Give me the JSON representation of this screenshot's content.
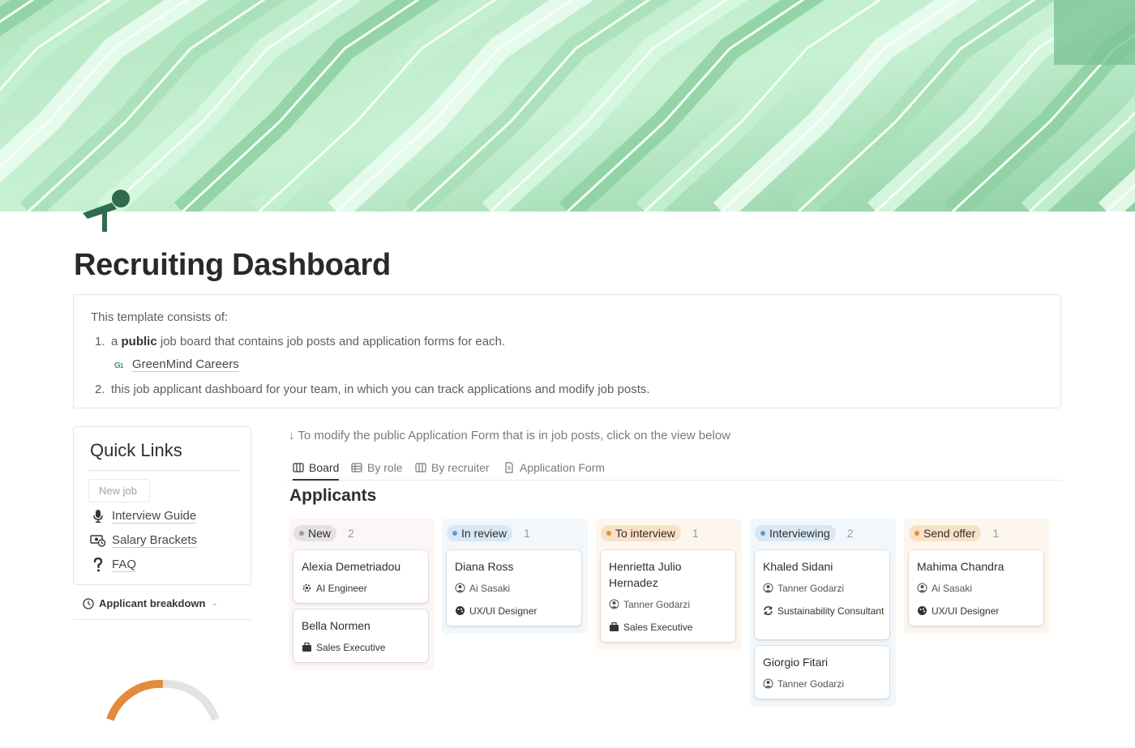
{
  "page": {
    "title": "Recruiting Dashboard",
    "icon": "microphone-icon"
  },
  "callout": {
    "intro": "This template consists of:",
    "item1_num": "1.",
    "item1_pre": "a ",
    "item1_bold": "public",
    "item1_post": " job board that contains job posts and application forms for each.",
    "item1_link": "GreenMind Careers",
    "item2_num": "2.",
    "item2_text": "this job applicant dashboard for your team, in which you can track applications and modify job posts."
  },
  "quick_links": {
    "title": "Quick Links",
    "new_job": "New job",
    "links": [
      {
        "label": "Interview Guide",
        "icon": "microphone-icon"
      },
      {
        "label": "Salary Brackets",
        "icon": "money-icon"
      },
      {
        "label": "FAQ",
        "icon": "question-icon"
      }
    ],
    "breakdown_label": "Applicant breakdown"
  },
  "board": {
    "hint": "↓ To modify the public Application Form that is in job posts, click on the view below",
    "tabs": [
      {
        "label": "Board",
        "icon": "board-icon",
        "active": true
      },
      {
        "label": "By role",
        "icon": "table-icon",
        "active": false
      },
      {
        "label": "By recruiter",
        "icon": "board-icon",
        "active": false
      },
      {
        "label": "Application Form",
        "icon": "form-icon",
        "active": false
      }
    ],
    "title": "Applicants",
    "columns": [
      {
        "label": "New",
        "count": "2",
        "dot": "#9b9a97",
        "pill_bg": "#e3e2e0",
        "bg": "#fdf6f6",
        "cards": [
          {
            "name": "Alexia Demetriadou",
            "props": [
              {
                "text": "AI Engineer",
                "icon": "gear-icon"
              }
            ]
          },
          {
            "name": "Bella Normen",
            "props": [
              {
                "text": "Sales Executive",
                "icon": "briefcase-icon"
              }
            ]
          }
        ]
      },
      {
        "label": "In review",
        "count": "1",
        "dot": "#5e9bcf",
        "pill_bg": "#d8e7f3",
        "bg": "#f1f7fb",
        "cards": [
          {
            "name": "Diana Ross",
            "props": [
              {
                "text": "Ai Sasaki",
                "icon": "avatar-icon",
                "muted": true
              },
              {
                "text": "UX/UI Designer",
                "icon": "palette-icon"
              }
            ]
          }
        ]
      },
      {
        "label": "To interview",
        "count": "1",
        "dot": "#e0903f",
        "pill_bg": "#fae0c6",
        "bg": "#fcf6ef",
        "cards": [
          {
            "name": "Henrietta Julio Hernadez",
            "props": [
              {
                "text": "Tanner Godarzi",
                "icon": "avatar-icon",
                "muted": true
              },
              {
                "text": "Sales Executive",
                "icon": "briefcase-icon"
              }
            ]
          }
        ]
      },
      {
        "label": "Interviewing",
        "count": "2",
        "dot": "#5e9bcf",
        "pill_bg": "#d8e7f3",
        "bg": "#f1f7fb",
        "cards": [
          {
            "name": "Khaled Sidani",
            "props": [
              {
                "text": "Tanner Godarzi",
                "icon": "avatar-icon",
                "muted": true
              },
              {
                "text": "Sustainability Consultant",
                "icon": "recycle-icon"
              }
            ]
          },
          {
            "name": "Giorgio Fitari",
            "props": [
              {
                "text": "Tanner Godarzi",
                "icon": "avatar-icon",
                "muted": true
              }
            ]
          }
        ]
      },
      {
        "label": "Send offer",
        "count": "1",
        "dot": "#e0903f",
        "pill_bg": "#fae0c6",
        "bg": "#fcf6ef",
        "cards": [
          {
            "name": "Mahima Chandra",
            "props": [
              {
                "text": "Ai Sasaki",
                "icon": "avatar-icon",
                "muted": true
              },
              {
                "text": "UX/UI Designer",
                "icon": "palette-icon"
              }
            ]
          }
        ]
      }
    ]
  },
  "colors": {
    "cover_green_light": "#c9f0d6",
    "cover_green_dark": "#5fb27a",
    "icon_green": "#2f6b4f",
    "donut_orange": "#e38b3d",
    "donut_grey": "#e4e3e0"
  }
}
